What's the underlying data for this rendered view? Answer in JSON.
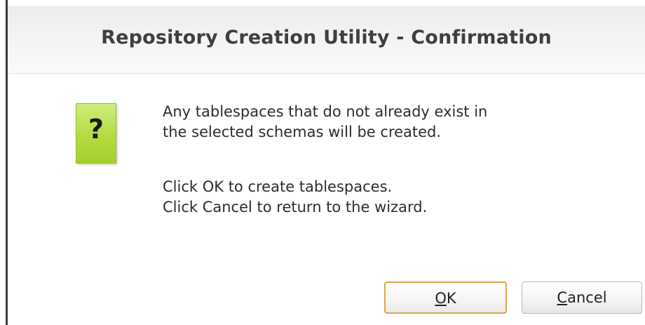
{
  "dialog": {
    "title": "Repository Creation Utility - Confirmation",
    "icon": "question-mark-icon",
    "icon_glyph": "?",
    "message_lines_1": [
      "Any tablespaces that do not already exist in",
      "the selected schemas will be created."
    ],
    "message_lines_2": [
      "Click OK to create tablespaces.",
      "Click Cancel to return to the wizard."
    ]
  },
  "buttons": {
    "ok": {
      "mnemonic": "O",
      "rest": "K"
    },
    "cancel": {
      "mnemonic": "C",
      "rest": "ancel"
    }
  },
  "colors": {
    "icon_fill": "#b3dc40",
    "ok_focus_border": "#e0a64a",
    "title_text": "#3f3f3f"
  }
}
